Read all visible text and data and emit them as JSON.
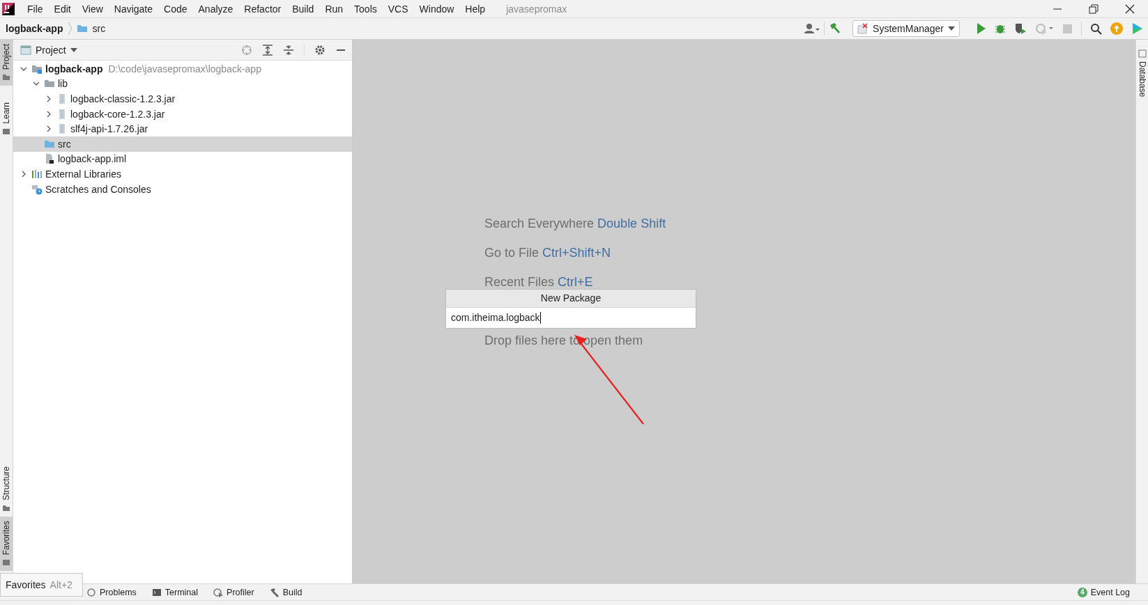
{
  "menu_bar": {
    "items": [
      "File",
      "Edit",
      "View",
      "Navigate",
      "Code",
      "Analyze",
      "Refactor",
      "Build",
      "Run",
      "Tools",
      "VCS",
      "Window",
      "Help"
    ],
    "project_name": "javasepromax"
  },
  "nav_bar": {
    "breadcrumbs": [
      "logback-app",
      "src"
    ],
    "run_config": "SystemManager"
  },
  "left_stripe": {
    "top": [
      {
        "label": "Project",
        "selected": true
      },
      {
        "label": "Learn",
        "selected": false
      }
    ],
    "bottom": [
      {
        "label": "Structure",
        "selected": false
      },
      {
        "label": "Favorites",
        "selected": true
      }
    ]
  },
  "right_stripe": [
    {
      "label": "Database",
      "selected": false
    }
  ],
  "project_panel": {
    "title": "Project",
    "tree": [
      {
        "name": "logback-app",
        "path": "D:\\code\\javasepromax\\logback-app",
        "kind": "module",
        "expanded": true,
        "selected": false,
        "children": [
          {
            "name": "lib",
            "kind": "folder",
            "expanded": true,
            "selected": false,
            "children": [
              {
                "name": "logback-classic-1.2.3.jar",
                "kind": "jar",
                "expanded": false,
                "selected": false
              },
              {
                "name": "logback-core-1.2.3.jar",
                "kind": "jar",
                "expanded": false,
                "selected": false
              },
              {
                "name": "slf4j-api-1.7.26.jar",
                "kind": "jar",
                "expanded": false,
                "selected": false
              }
            ]
          },
          {
            "name": "src",
            "kind": "source",
            "selected": true
          },
          {
            "name": "logback-app.iml",
            "kind": "file",
            "selected": false
          }
        ]
      },
      {
        "name": "External Libraries",
        "kind": "libraries",
        "expanded": false,
        "selected": false
      },
      {
        "name": "Scratches and Consoles",
        "kind": "scratches",
        "selected": false
      }
    ]
  },
  "editor": {
    "hints": [
      {
        "text": "Search Everywhere",
        "shortcut": "Double Shift"
      },
      {
        "text": "Go to File",
        "shortcut": "Ctrl+Shift+N"
      },
      {
        "text": "Recent Files",
        "shortcut": "Ctrl+E"
      },
      {
        "text": "Drop files here to open them"
      }
    ]
  },
  "new_package_popup": {
    "title": "New Package",
    "value": "com.itheima.logback"
  },
  "tooltip": {
    "text": "Favorites",
    "shortcut": "Alt+2"
  },
  "bottom_bar": {
    "tabs": [
      {
        "label": "Problems",
        "kind": "problems"
      },
      {
        "label": "Terminal",
        "kind": "terminal"
      },
      {
        "label": "Profiler",
        "kind": "profiler"
      },
      {
        "label": "Build",
        "kind": "build"
      }
    ],
    "event_log": {
      "count": "4",
      "label": "Event Log"
    }
  }
}
